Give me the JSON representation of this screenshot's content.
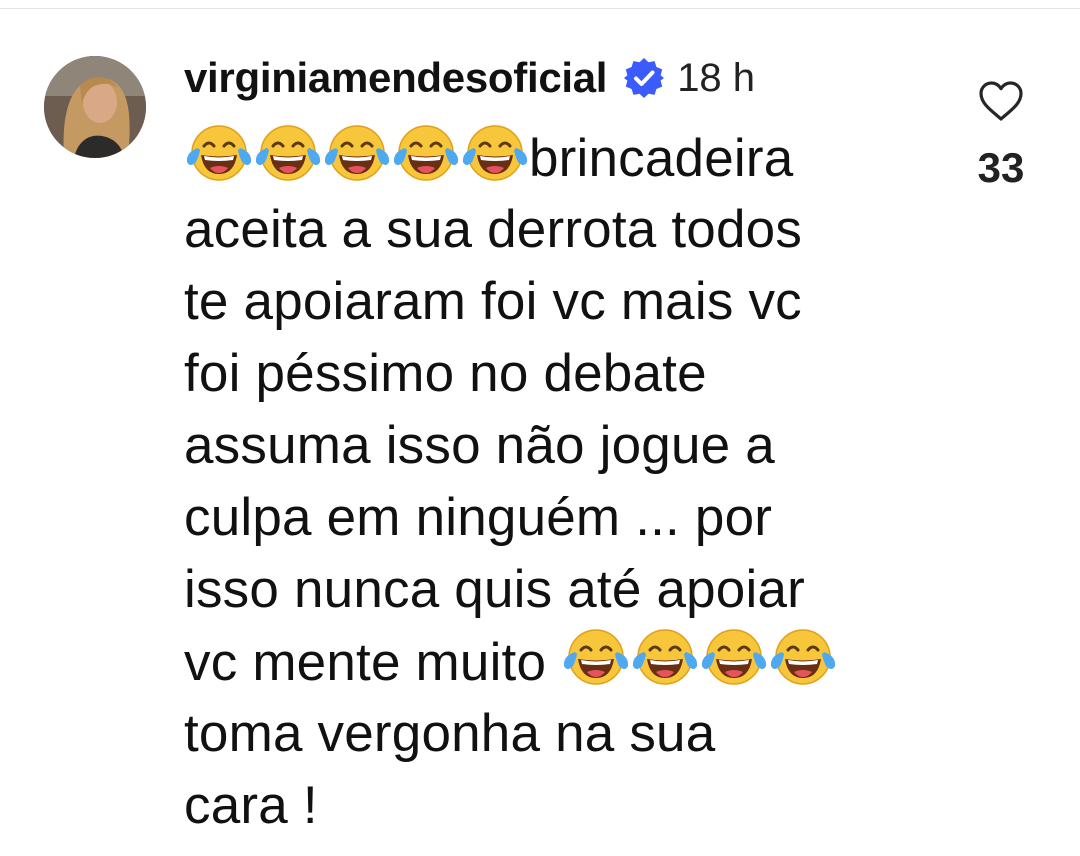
{
  "comment": {
    "username": "virginiamendesoficial",
    "verified_icon": "verified-badge-icon",
    "time_ago": "18 h",
    "emoji_name": "face-with-tears-of-joy-icon",
    "lines": [
      {
        "pre_emojis": 5,
        "text": "brincadeira"
      },
      {
        "text": "aceita a sua derrota todos"
      },
      {
        "text": "te apoiaram foi vc mais vc"
      },
      {
        "text": "foi péssimo no debate"
      },
      {
        "text": "assuma isso não jogue a"
      },
      {
        "text": "culpa em ninguém ... por"
      },
      {
        "text": "isso nunca quis até apoiar"
      },
      {
        "text": "vc mente muito ",
        "post_emojis": 4
      },
      {
        "text": "toma vergonha na sua"
      },
      {
        "text": "cara !"
      }
    ],
    "like_icon": "heart-outline-icon",
    "like_count": "33"
  },
  "colors": {
    "verified_blue": "#3b5bfd",
    "text": "#111111",
    "divider": "#e4e4e4"
  }
}
